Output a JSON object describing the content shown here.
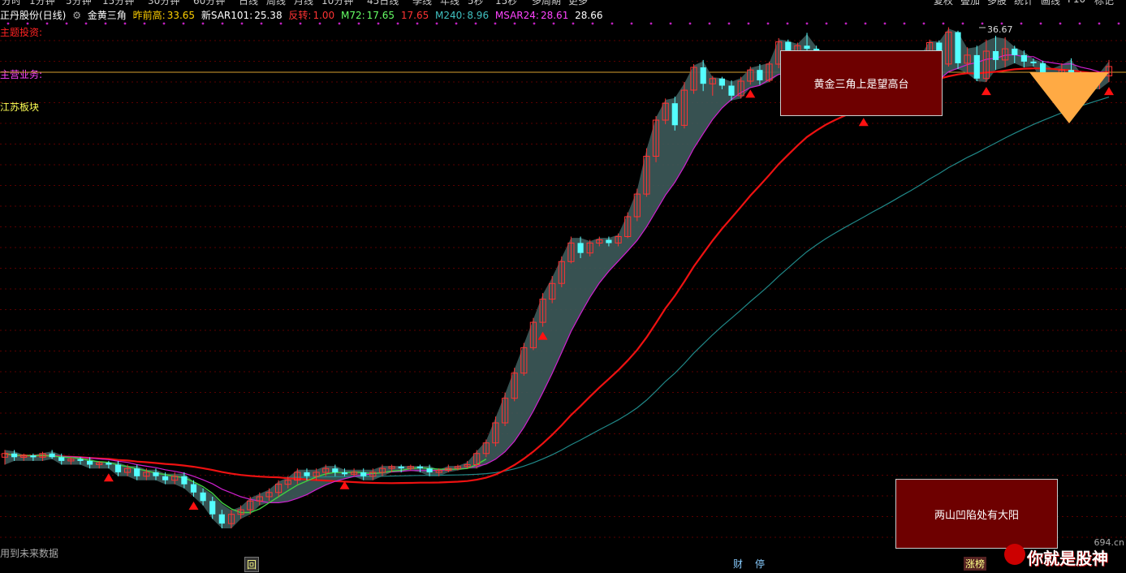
{
  "toolbar": {
    "left_items": [
      "分时",
      "1分钟",
      "5分钟",
      "15分钟",
      "30分钟",
      "60分钟",
      "日线",
      "周线",
      "月线",
      "10分钟",
      "45日线",
      "季线",
      "年线",
      "5秒",
      "15秒",
      "多周期",
      "更多"
    ],
    "right_items": [
      "复权",
      "叠加",
      "多股",
      "统计",
      "画线",
      "F10",
      "标记"
    ]
  },
  "header": {
    "stock": "正丹股份(日线)",
    "indicator": "金黄三角",
    "prev_high_label": "昨前高:",
    "prev_high_value": "33.65",
    "sar_label": "新SAR101:",
    "sar_value": "25.38",
    "reverse_label": "反转:",
    "reverse_value": "1.00",
    "m72_label": "M72:",
    "m72_value": "17.65",
    "m72_value2": "17.65",
    "m240_label": "M240:",
    "m240_value": "8.96",
    "msar_label": "MSAR24:",
    "msar_value": "28.61",
    "msar_value2": "28.66"
  },
  "side": {
    "theme": "主题投资:",
    "business": "主营业务:",
    "sector": "江苏板块"
  },
  "annotations": {
    "top_box": "黄金三角上是望高台",
    "bottom_box": "两山凹陷处有大阳",
    "footer_note": "用到未来数据",
    "tag_hui": "回",
    "tag_cai": "财",
    "tag_ting": "停",
    "tag_zhangting": "涨榜",
    "watermark": "你就是股神",
    "watermark_site": "694.cn"
  },
  "colors": {
    "up": "#ff3333",
    "down": "#54ffff",
    "ribbon": "#3d5a5a",
    "ma_magenta": "#d020d0",
    "ma_red": "#ee1111",
    "ma_teal": "#208888",
    "triangle": "#ffaa44",
    "box_bg": "#6e0000"
  },
  "chart_data": {
    "type": "candlestick",
    "high_marker": "36.67",
    "price_range": [
      5,
      38
    ],
    "candles": [
      [
        7.2,
        7.3,
        7.0,
        7.4
      ],
      [
        7.3,
        7.2,
        7.1,
        7.4
      ],
      [
        7.2,
        7.25,
        7.1,
        7.3
      ],
      [
        7.25,
        7.2,
        7.1,
        7.3
      ],
      [
        7.2,
        7.3,
        7.1,
        7.35
      ],
      [
        7.3,
        7.2,
        7.15,
        7.4
      ],
      [
        7.2,
        7.1,
        7.0,
        7.3
      ],
      [
        7.1,
        7.15,
        7.0,
        7.2
      ],
      [
        7.15,
        7.1,
        7.0,
        7.2
      ],
      [
        7.1,
        7.0,
        6.9,
        7.2
      ],
      [
        7.0,
        7.05,
        6.9,
        7.1
      ],
      [
        7.05,
        7.0,
        6.9,
        7.1
      ],
      [
        7.0,
        6.8,
        6.7,
        7.1
      ],
      [
        6.8,
        6.9,
        6.7,
        7.0
      ],
      [
        6.9,
        6.7,
        6.6,
        7.0
      ],
      [
        6.7,
        6.8,
        6.6,
        6.9
      ],
      [
        6.8,
        6.7,
        6.6,
        6.9
      ],
      [
        6.7,
        6.6,
        6.5,
        6.8
      ],
      [
        6.6,
        6.7,
        6.5,
        6.8
      ],
      [
        6.7,
        6.5,
        6.4,
        6.8
      ],
      [
        6.5,
        6.3,
        6.2,
        6.6
      ],
      [
        6.3,
        6.1,
        6.0,
        6.4
      ],
      [
        6.1,
        5.8,
        5.7,
        6.2
      ],
      [
        5.8,
        5.6,
        5.5,
        5.9
      ],
      [
        5.6,
        5.8,
        5.5,
        5.9
      ],
      [
        5.8,
        5.9,
        5.7,
        6.0
      ],
      [
        5.9,
        6.1,
        5.8,
        6.2
      ],
      [
        6.1,
        6.2,
        6.0,
        6.3
      ],
      [
        6.2,
        6.3,
        6.1,
        6.4
      ],
      [
        6.3,
        6.5,
        6.2,
        6.6
      ],
      [
        6.5,
        6.6,
        6.4,
        6.7
      ],
      [
        6.6,
        6.8,
        6.5,
        6.9
      ],
      [
        6.8,
        6.7,
        6.6,
        6.9
      ],
      [
        6.7,
        6.8,
        6.6,
        6.9
      ],
      [
        6.8,
        6.9,
        6.7,
        7.0
      ],
      [
        6.9,
        6.8,
        6.7,
        7.0
      ],
      [
        6.8,
        6.75,
        6.7,
        6.9
      ],
      [
        6.75,
        6.8,
        6.7,
        6.9
      ],
      [
        6.8,
        6.7,
        6.6,
        6.9
      ],
      [
        6.7,
        6.8,
        6.6,
        6.9
      ],
      [
        6.8,
        6.9,
        6.7,
        7.0
      ],
      [
        6.9,
        6.95,
        6.8,
        7.0
      ],
      [
        6.95,
        6.9,
        6.8,
        7.0
      ],
      [
        6.9,
        6.95,
        6.85,
        7.0
      ],
      [
        6.95,
        6.9,
        6.8,
        7.0
      ],
      [
        6.9,
        6.8,
        6.7,
        7.0
      ],
      [
        6.8,
        6.85,
        6.7,
        6.9
      ],
      [
        6.85,
        6.9,
        6.8,
        7.0
      ],
      [
        6.9,
        6.95,
        6.85,
        7.0
      ],
      [
        6.95,
        7.0,
        6.9,
        7.1
      ],
      [
        7.0,
        7.3,
        6.9,
        7.4
      ],
      [
        7.3,
        7.6,
        7.2,
        7.7
      ],
      [
        7.6,
        8.2,
        7.5,
        8.4
      ],
      [
        8.2,
        9.0,
        8.1,
        9.2
      ],
      [
        9.0,
        9.9,
        8.9,
        10.1
      ],
      [
        9.9,
        10.9,
        9.8,
        11.1
      ],
      [
        10.9,
        12.0,
        10.8,
        12.2
      ],
      [
        12.0,
        13.1,
        11.8,
        13.4
      ],
      [
        13.1,
        13.9,
        12.9,
        14.3
      ],
      [
        13.9,
        15.1,
        13.7,
        15.4
      ],
      [
        15.1,
        16.2,
        15.0,
        16.6
      ],
      [
        16.2,
        15.6,
        15.3,
        16.6
      ],
      [
        15.6,
        16.2,
        15.4,
        16.4
      ],
      [
        16.2,
        16.4,
        16.0,
        16.6
      ],
      [
        16.4,
        16.2,
        16.0,
        16.6
      ],
      [
        16.2,
        16.6,
        16.0,
        16.8
      ],
      [
        16.6,
        17.9,
        16.5,
        18.2
      ],
      [
        17.9,
        19.5,
        17.6,
        19.9
      ],
      [
        19.5,
        22.5,
        19.3,
        23.2
      ],
      [
        22.5,
        25.8,
        22.0,
        26.2
      ],
      [
        25.8,
        27.5,
        25.4,
        28.0
      ],
      [
        27.5,
        25.3,
        24.8,
        28.2
      ],
      [
        25.3,
        28.9,
        25.0,
        29.8
      ],
      [
        28.9,
        31.5,
        28.5,
        31.9
      ],
      [
        31.5,
        29.6,
        28.8,
        32.4
      ],
      [
        29.6,
        30.2,
        28.3,
        30.5
      ],
      [
        30.2,
        29.4,
        29.0,
        30.4
      ],
      [
        29.4,
        28.3,
        27.8,
        30.0
      ],
      [
        28.3,
        29.9,
        28.0,
        30.4
      ],
      [
        29.9,
        31.2,
        29.5,
        31.6
      ],
      [
        31.2,
        30.0,
        29.5,
        31.9
      ],
      [
        30.0,
        31.9,
        29.8,
        32.2
      ],
      [
        31.9,
        34.7,
        31.4,
        35.2
      ],
      [
        34.7,
        32.6,
        32.3,
        35.0
      ],
      [
        32.6,
        34.2,
        32.2,
        34.6
      ],
      [
        34.2,
        33.8,
        32.4,
        35.9
      ],
      [
        33.8,
        30.2,
        29.8,
        34.2
      ],
      [
        30.2,
        29.6,
        29.0,
        30.8
      ],
      [
        29.6,
        27.8,
        27.4,
        30.0
      ],
      [
        27.8,
        27.8,
        27.0,
        28.4
      ],
      [
        27.8,
        26.8,
        26.5,
        28.2
      ],
      [
        26.8,
        27.9,
        26.5,
        28.5
      ],
      [
        27.9,
        28.6,
        27.5,
        29.2
      ],
      [
        28.6,
        27.8,
        27.4,
        29.0
      ],
      [
        27.8,
        29.4,
        27.3,
        29.9
      ],
      [
        29.4,
        31.2,
        29.0,
        31.6
      ],
      [
        31.2,
        30.0,
        29.6,
        31.6
      ],
      [
        30.0,
        32.5,
        29.8,
        33.0
      ],
      [
        32.5,
        34.6,
        32.0,
        35.0
      ],
      [
        34.6,
        31.9,
        31.4,
        34.9
      ],
      [
        31.9,
        36.0,
        31.6,
        36.67
      ],
      [
        36.0,
        32.0,
        31.3,
        36.2
      ],
      [
        32.0,
        33.0,
        30.8,
        34.0
      ],
      [
        33.0,
        30.2,
        29.9,
        34.2
      ],
      [
        30.2,
        33.5,
        29.8,
        35.0
      ],
      [
        33.5,
        32.4,
        31.2,
        35.5
      ],
      [
        32.4,
        33.8,
        31.5,
        35.3
      ],
      [
        33.8,
        33.0,
        32.0,
        34.2
      ],
      [
        33.0,
        32.2,
        31.5,
        33.6
      ],
      [
        32.2,
        32.0,
        31.6,
        32.6
      ],
      [
        32.0,
        30.1,
        29.6,
        32.3
      ],
      [
        30.1,
        30.3,
        29.8,
        30.6
      ],
      [
        30.3,
        31.2,
        29.8,
        32.0
      ],
      [
        31.2,
        30.8,
        30.2,
        32.6
      ],
      [
        30.8,
        29.5,
        29.0,
        31.0
      ],
      [
        29.5,
        30.0,
        29.0,
        30.4
      ],
      [
        30.0,
        30.5,
        29.0,
        31.0
      ],
      [
        30.5,
        31.6,
        29.8,
        32.4
      ]
    ]
  }
}
